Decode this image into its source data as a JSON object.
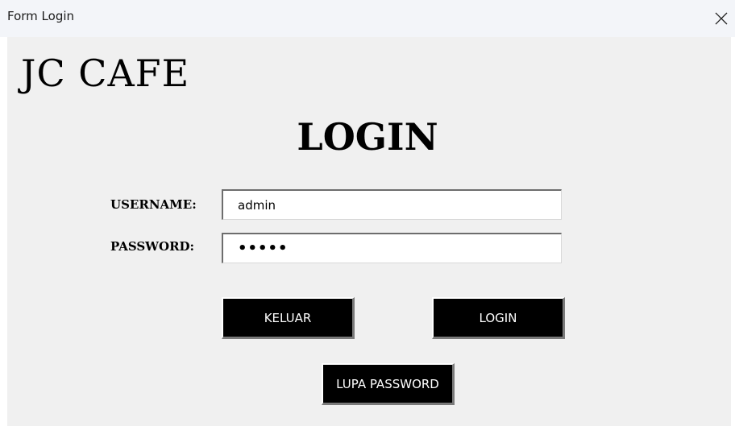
{
  "window": {
    "title": "Form Login"
  },
  "brand": {
    "name": "JC CAFE"
  },
  "form": {
    "heading": "LOGIN",
    "username_label": "USERNAME:",
    "username_value": "admin",
    "password_label": "PASSWORD:",
    "password_value": "•••••"
  },
  "buttons": {
    "keluar_label": "KELUAR",
    "login_label": "LOGIN",
    "lupa_password_label": "LUPA PASSWORD"
  },
  "icons": {
    "close": "close-icon"
  },
  "colors": {
    "button_bg": "#000000",
    "button_text": "#ffffff",
    "window_bg": "#f0f0f0",
    "titlebar_bg": "#f3f5f9"
  }
}
